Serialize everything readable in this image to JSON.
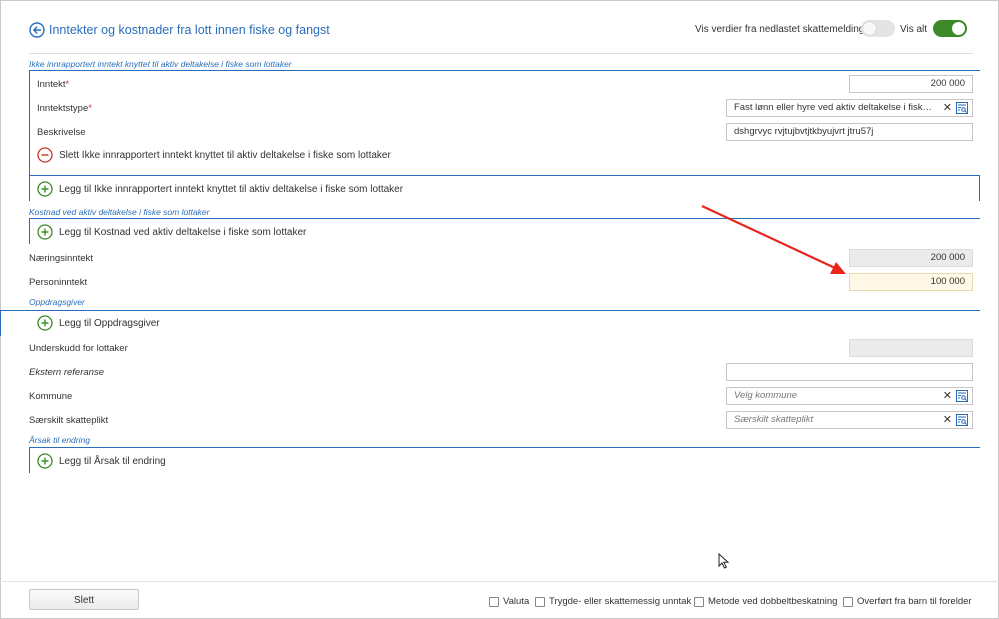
{
  "header": {
    "title": "Inntekter og kostnader fra lott innen fiske og fangst",
    "toggle_label": "Vis verdier fra nedlastet skattemelding:",
    "vis_alt_label": "Vis alt"
  },
  "section1": {
    "title": "Ikke innrapportert inntekt knyttet til aktiv deltakelse i fiske som lottaker",
    "inntekt_label": "Inntekt",
    "inntekt_value": "200 000",
    "inntektstype_label": "Inntektstype",
    "inntektstype_value": "Fast lønn eller hyre ved aktiv deltakelse i fiske, in...",
    "beskrivelse_label": "Beskrivelse",
    "beskrivelse_value": "dshgrvyc rvjtujbvtjtkbyujvrt jtru57j",
    "delete_label": "Slett Ikke innrapportert inntekt knyttet til aktiv deltakelse i fiske som lottaker",
    "add_label": "Legg til Ikke innrapportert inntekt knyttet til aktiv deltakelse i fiske som lottaker"
  },
  "section2": {
    "title": "Kostnad ved aktiv deltakelse i fiske som lottaker",
    "add_label": "Legg til Kostnad ved aktiv deltakelse i fiske som lottaker"
  },
  "naeringsinntekt": {
    "label": "Næringsinntekt",
    "value": "200 000"
  },
  "personinntekt": {
    "label": "Personinntekt",
    "value": "100 000"
  },
  "section3": {
    "title": "Oppdragsgiver",
    "add_label": "Legg til Oppdragsgiver"
  },
  "underskudd": {
    "label": "Underskudd for lottaker"
  },
  "ekstern": {
    "label": "Ekstern referanse"
  },
  "kommune": {
    "label": "Kommune",
    "placeholder": "Velg kommune"
  },
  "saerskilt": {
    "label": "Særskilt skatteplikt",
    "placeholder": "Særskilt skatteplikt"
  },
  "section4": {
    "title": "Årsak til endring",
    "add_label": "Legg til Årsak til endring"
  },
  "footer": {
    "slett_label": "Slett",
    "checkboxes": [
      {
        "label": "Valuta"
      },
      {
        "label": "Trygde- eller skattemessig unntak"
      },
      {
        "label": "Metode ved dobbeltbeskatning"
      },
      {
        "label": "Overført fra barn til forelder"
      }
    ]
  },
  "colors": {
    "accent": "#2a6ebb",
    "toggle_on": "#3b8a27",
    "delete": "#c0392b",
    "add": "#3b8a27",
    "arrow": "#e8241c"
  },
  "icons": {
    "back": "back-arrow-icon",
    "delete": "minus-circle-icon",
    "add": "plus-circle-icon",
    "clear": "close-icon",
    "lookup": "search-list-icon",
    "cursor": "mouse-pointer-icon"
  }
}
